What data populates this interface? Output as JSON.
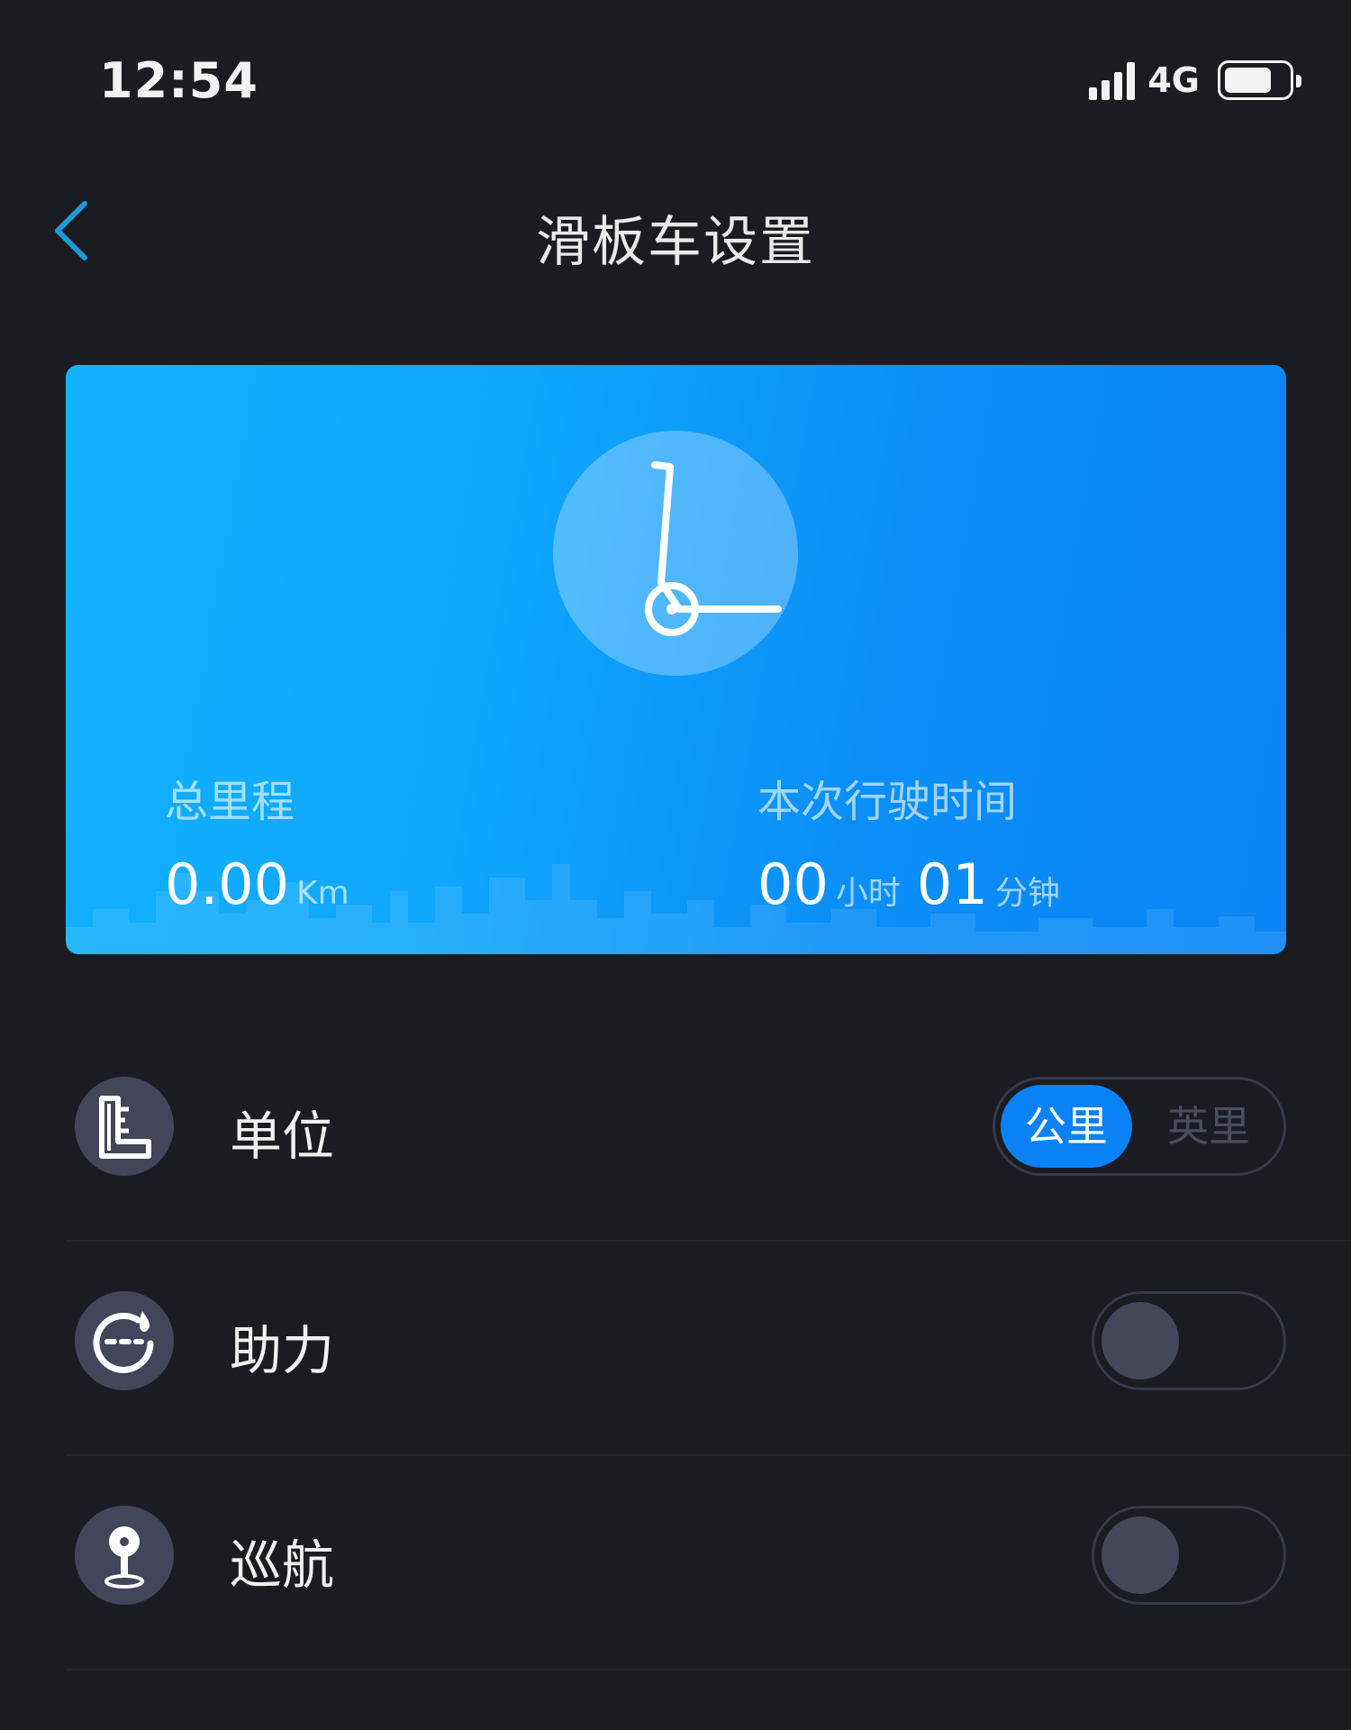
{
  "status_bar": {
    "time": "12:54",
    "network": "4G",
    "battery_level": 0.75
  },
  "header": {
    "title": "滑板车设置"
  },
  "card": {
    "total_mileage_label": "总里程",
    "total_mileage_value": "0.00",
    "total_mileage_unit": "Km",
    "ride_time_label": "本次行驶时间",
    "ride_hours": "00",
    "hours_unit": "小时",
    "ride_minutes": "01",
    "minutes_unit": "分钟"
  },
  "settings": {
    "unit": {
      "label": "单位",
      "options": [
        "公里",
        "英里"
      ],
      "selected": "公里"
    },
    "assist": {
      "label": "助力",
      "enabled": false
    },
    "cruise": {
      "label": "巡航",
      "enabled": false
    }
  },
  "colors": {
    "background": "#1b1c21",
    "accent": "#0a82f5",
    "back_arrow": "#1e9bd6",
    "icon_circle": "#43455a"
  }
}
